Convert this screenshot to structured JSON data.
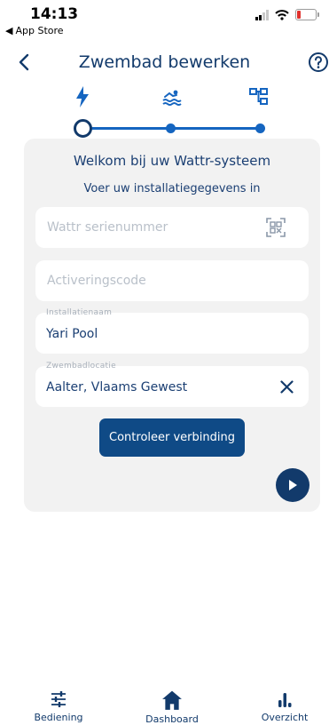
{
  "status_bar": {
    "time": "14:13",
    "back_app_label": "App Store",
    "battery_color": "#e0302b"
  },
  "header": {
    "title": "Zwembad bewerken",
    "back_icon": "chevron-left-icon",
    "help_icon": "help-circle-icon"
  },
  "stepper": {
    "steps": [
      {
        "icon": "lightning-icon",
        "state": "current"
      },
      {
        "icon": "pool-swimmer-icon",
        "state": "upcoming"
      },
      {
        "icon": "network-nodes-icon",
        "state": "upcoming"
      }
    ]
  },
  "card": {
    "welcome": "Welkom bij uw Wattr-systeem",
    "instruction": "Voer uw installatiegegevens in",
    "serial": {
      "placeholder": "Wattr serienummer",
      "icon": "qr-scan-icon"
    },
    "activation": {
      "placeholder": "Activeringscode"
    },
    "installation": {
      "label": "Installatienaam",
      "value": "Yari Pool"
    },
    "location": {
      "label": "Zwembadlocatie",
      "value": "Aalter, Vlaams Gewest",
      "clear_icon": "close-icon"
    },
    "verify_button": "Controleer verbinding",
    "next_icon": "play-icon"
  },
  "bottom_nav": {
    "items": [
      {
        "label": "Bediening",
        "icon": "sliders-icon"
      },
      {
        "label": "Dashboard",
        "icon": "home-icon"
      },
      {
        "label": "Overzicht",
        "icon": "bar-chart-icon"
      }
    ]
  },
  "colors": {
    "primary": "#123a6b",
    "accent": "#1565c0",
    "button": "#0f4a86",
    "card_bg": "#f2f2f2"
  }
}
